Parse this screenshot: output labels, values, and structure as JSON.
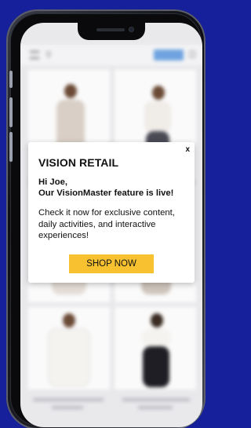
{
  "popup": {
    "title": "VISION RETAIL",
    "close_label": "x",
    "greeting_line1": "Hi Joe,",
    "greeting_line2": "Our VisionMaster feature is live!",
    "body": "Check it now for exclusive content, daily activities, and interactive experiences!",
    "cta_label": "SHOP NOW"
  },
  "app_background": {
    "icons": {
      "menu": "hamburger-icon",
      "search": "search-icon",
      "cart": "cart-icon"
    },
    "accent_button_color": "#6fa3e0"
  },
  "colors": {
    "background": "#15209a",
    "cta": "#f7c12f",
    "popup_bg": "#ffffff"
  }
}
